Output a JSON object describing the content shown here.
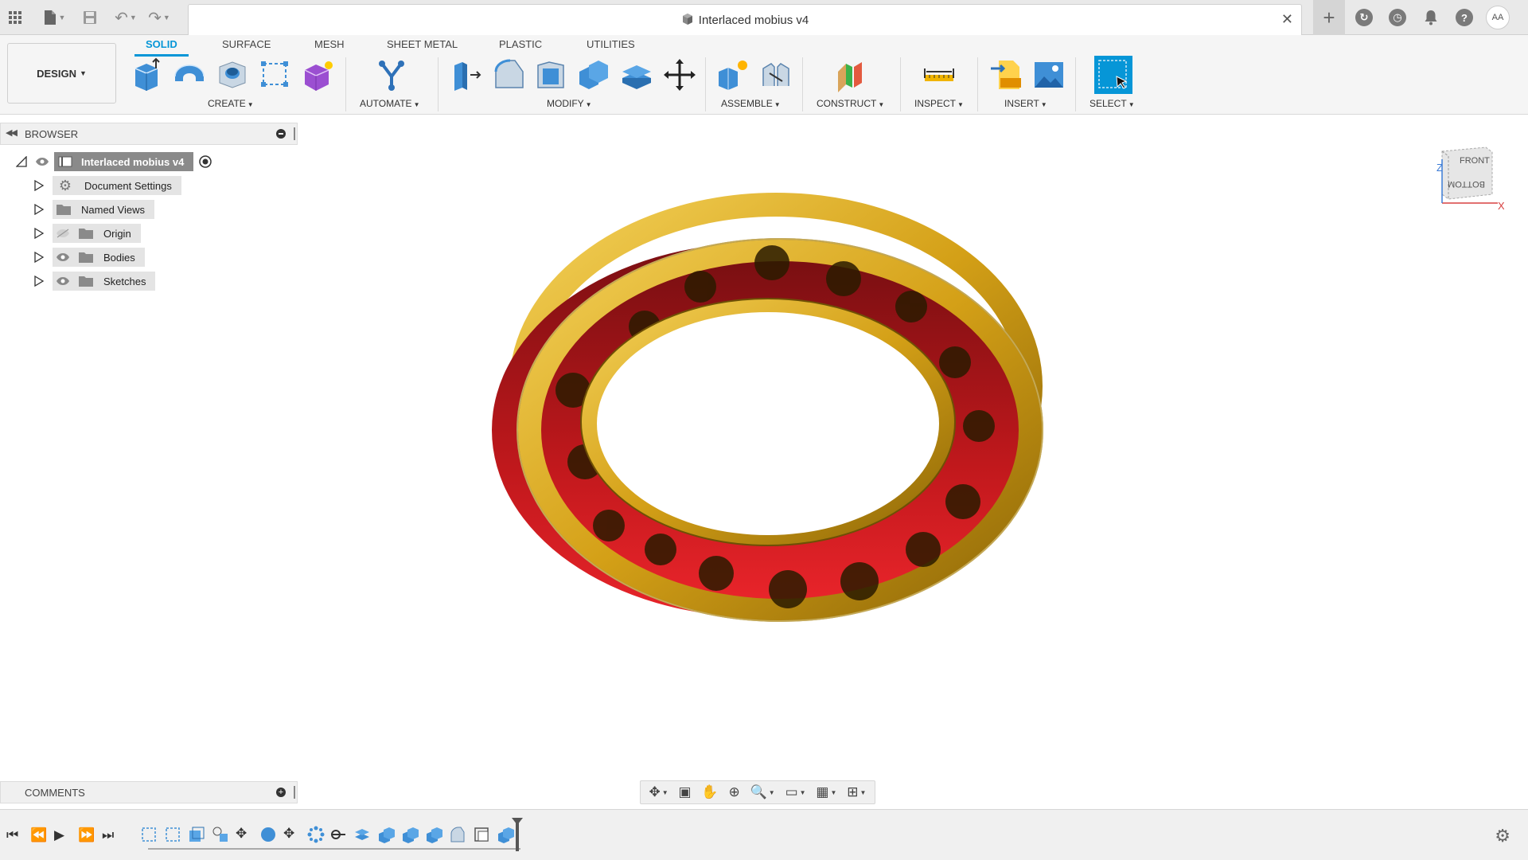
{
  "titlebar": {
    "document_title": "Interlaced mobius v4",
    "close_glyph": "✕",
    "user_initials": "AA"
  },
  "ribbon": {
    "workspace_label": "DESIGN",
    "tabs": [
      {
        "label": "SOLID",
        "active": true
      },
      {
        "label": "SURFACE",
        "active": false
      },
      {
        "label": "MESH",
        "active": false
      },
      {
        "label": "SHEET METAL",
        "active": false
      },
      {
        "label": "PLASTIC",
        "active": false
      },
      {
        "label": "UTILITIES",
        "active": false
      }
    ],
    "groups": {
      "create": "CREATE",
      "automate": "AUTOMATE",
      "modify": "MODIFY",
      "assemble": "ASSEMBLE",
      "construct": "CONSTRUCT",
      "inspect": "INSPECT",
      "insert": "INSERT",
      "select": "SELECT"
    },
    "accent_color": "#0696d7"
  },
  "browser": {
    "title": "BROWSER",
    "root": "Interlaced mobius v4",
    "items": [
      {
        "label": "Document Settings",
        "icon": "gear-icon"
      },
      {
        "label": "Named Views",
        "icon": "folder-icon"
      },
      {
        "label": "Origin",
        "icon": "folder-icon",
        "hidden": true
      },
      {
        "label": "Bodies",
        "icon": "folder-icon"
      },
      {
        "label": "Sketches",
        "icon": "folder-icon"
      }
    ]
  },
  "viewcube": {
    "front": "FRONT",
    "bottom": "BOTTOM",
    "axis_z": "Z",
    "axis_x": "X"
  },
  "comments": {
    "title": "COMMENTS"
  },
  "model": {
    "gold_color": "#d4a017",
    "red_color": "#c0181c"
  }
}
